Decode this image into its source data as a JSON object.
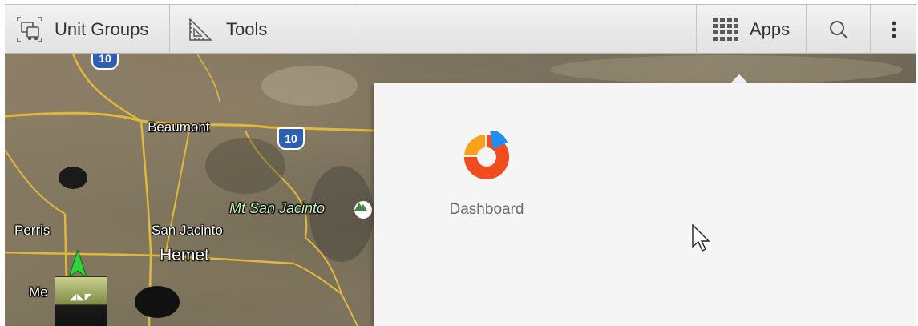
{
  "toolbar": {
    "unit_groups_label": "Unit Groups",
    "tools_label": "Tools",
    "apps_label": "Apps"
  },
  "map": {
    "labels": {
      "beaumont": "Beaumont",
      "mt_san_jacinto": "Mt San Jacinto",
      "perris": "Perris",
      "san_jacinto": "San Jacinto",
      "hemet": "Hemet",
      "partial_city": "Me"
    },
    "highway_shield": "10",
    "road_color": "#e0b93a"
  },
  "apps_panel": {
    "apps": [
      {
        "label": "Dashboard",
        "icon": "dashboard-pie-icon"
      }
    ],
    "colors": {
      "pie_red": "#f24b1d",
      "pie_orange": "#f7a21b",
      "pie_blue": "#1e8ff0"
    }
  }
}
